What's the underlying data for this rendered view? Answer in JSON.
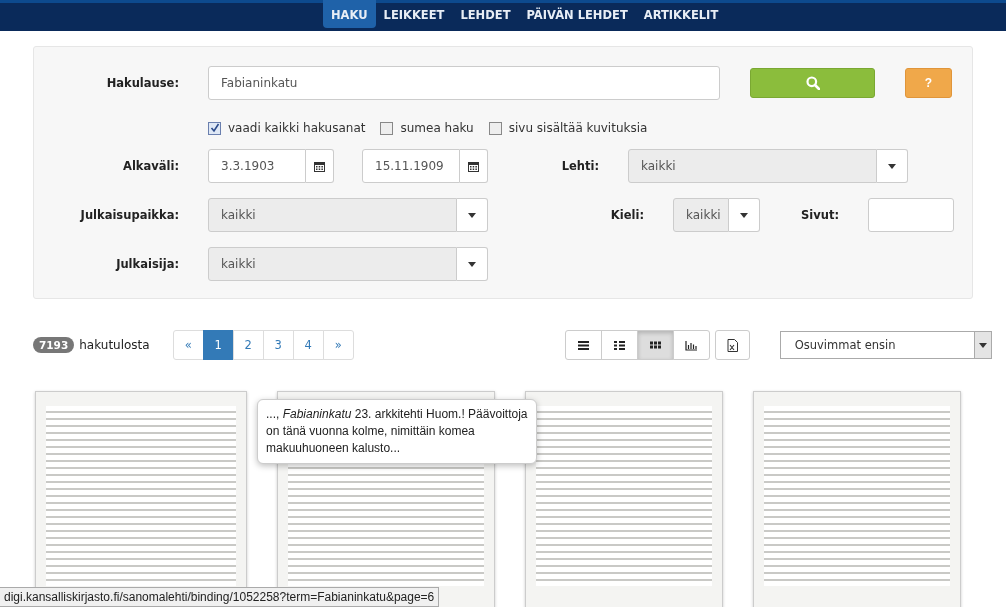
{
  "nav": {
    "tabs": [
      {
        "label": "HAKU",
        "selected": true
      },
      {
        "label": "LEIKKEET",
        "selected": false
      },
      {
        "label": "LEHDET",
        "selected": false
      },
      {
        "label": "PÄIVÄN LEHDET",
        "selected": false
      },
      {
        "label": "ARTIKKELIT",
        "selected": false
      }
    ]
  },
  "search": {
    "label": "Hakulause:",
    "value": "Fabianinkatu",
    "help": "?"
  },
  "options": [
    {
      "label": "vaadi kaikki hakusanat",
      "checked": true
    },
    {
      "label": "sumea haku",
      "checked": false
    },
    {
      "label": "sivu sisältää kuvituksia",
      "checked": false
    }
  ],
  "date_range": {
    "label": "Alkaväli:",
    "start": "3.3.1903",
    "end": "15.11.1909"
  },
  "lehti": {
    "label": "Lehti:",
    "value": "kaikki"
  },
  "julkaisupaikka": {
    "label": "Julkaisupaikka:",
    "value": "kaikki"
  },
  "kieli": {
    "label": "Kieli:",
    "value": "kaikki"
  },
  "sivut": {
    "label": "Sivut:"
  },
  "julkaisija": {
    "label": "Julkaisija:",
    "value": "kaikki"
  },
  "results": {
    "count": "7193",
    "label": "hakutulosta",
    "pages": [
      {
        "label": "«",
        "selected": false
      },
      {
        "label": "1",
        "selected": true
      },
      {
        "label": "2",
        "selected": false
      },
      {
        "label": "3",
        "selected": false
      },
      {
        "label": "4",
        "selected": false
      },
      {
        "label": "»",
        "selected": false
      }
    ],
    "views": [
      {
        "kind": "list",
        "selected": false
      },
      {
        "kind": "detail",
        "selected": false
      },
      {
        "kind": "grid",
        "selected": true
      },
      {
        "kind": "chart",
        "selected": false
      }
    ],
    "sort": "Osuvimmat ensin"
  },
  "tooltip": "..., *Fabianinkatu* 23. arkkitehti Huom.! Päävoittoja on tänä vuonna kolme, nimittäin komea makuuhuoneen kalusto...",
  "status_url": "digi.kansalliskirjasto.fi/sanomalehti/binding/1052258?term=Fabianinkatu&page=6"
}
